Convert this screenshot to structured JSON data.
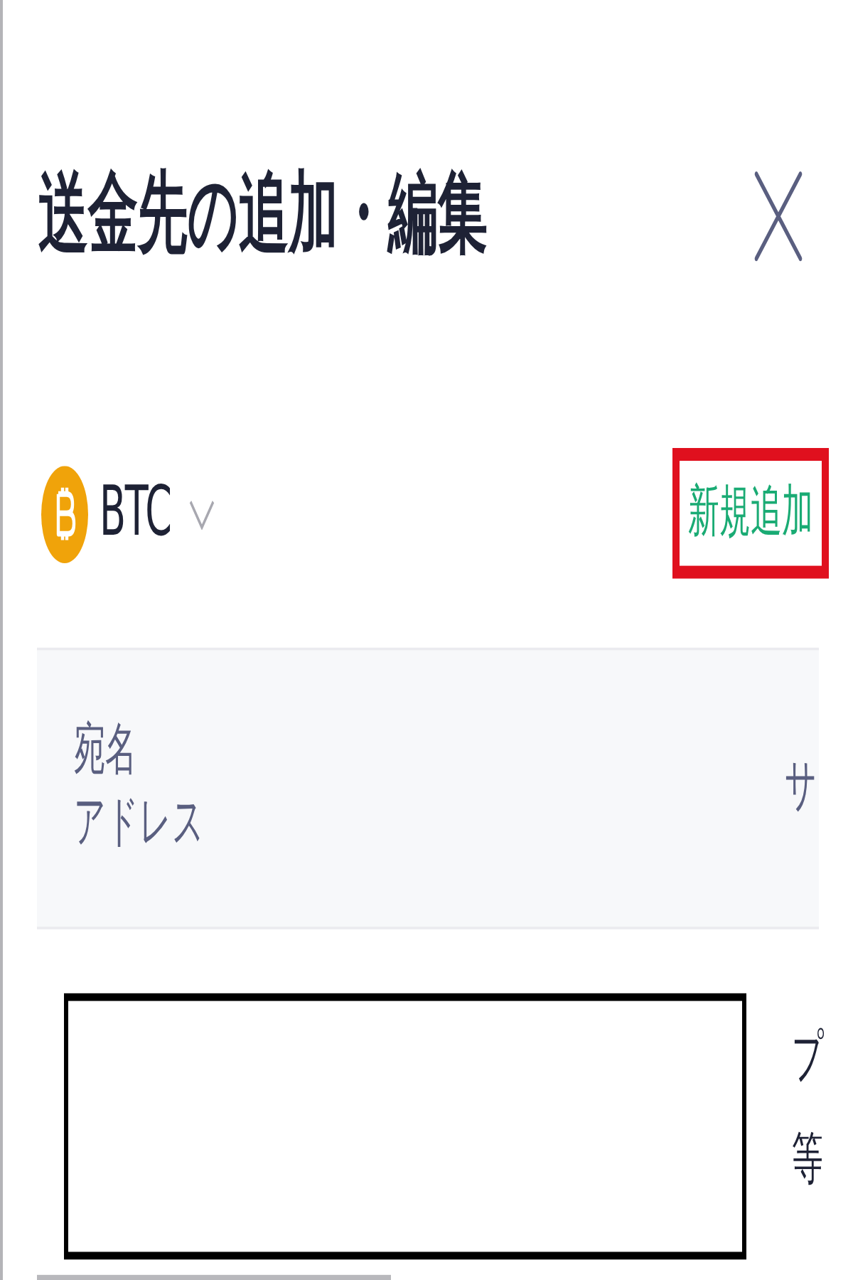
{
  "dialog": {
    "title": "送金先の追加・編集"
  },
  "currency_selector": {
    "symbol": "BTC"
  },
  "add_button": {
    "label": "新規追加",
    "highlighted": true
  },
  "table": {
    "columns": [
      {
        "lines": [
          "宛名",
          "アドレス"
        ]
      },
      {
        "lines": [
          "サ"
        ]
      }
    ],
    "rows": [
      {
        "cells": [
          {
            "kind": "redacted"
          },
          {
            "kind": "text",
            "lines": [
              "プ",
              "等"
            ]
          }
        ]
      }
    ]
  }
}
